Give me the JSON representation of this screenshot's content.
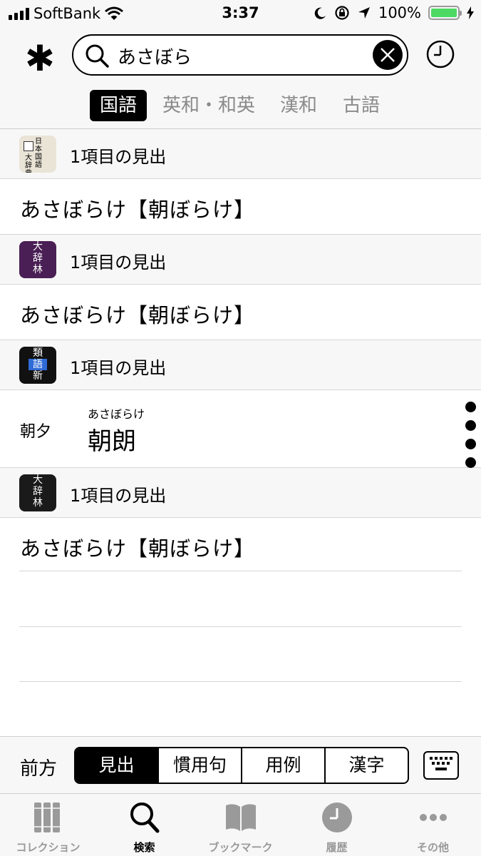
{
  "status_bar": {
    "carrier": "SoftBank",
    "time": "3:37",
    "battery": "100%",
    "battery_level": 1.0
  },
  "search": {
    "query": "あさぼら"
  },
  "header": {
    "asterisk": "✱"
  },
  "dict_tabs": [
    {
      "label": "国語",
      "active": true
    },
    {
      "label": "英和・和英",
      "active": false
    },
    {
      "label": "漢和",
      "active": false
    },
    {
      "label": "古語",
      "active": false
    }
  ],
  "sections": [
    {
      "title": "1項目の見出",
      "icon": "nihon-kokugo-daijiten-icon",
      "icon_text": [
        "日本国語",
        "大辞典"
      ],
      "entry": "あさぼらけ【朝ぼらけ】"
    },
    {
      "title": "1項目の見出",
      "icon": "daijirin-purple-icon",
      "icon_text": [
        "大",
        "辞",
        "林"
      ],
      "entry": "あさぼらけ【朝ぼらけ】"
    },
    {
      "title": "1項目の見出",
      "icon": "ruigo-shin-icon",
      "icon_text": [
        "類",
        "語",
        "新"
      ],
      "special": {
        "label": "朝夕",
        "ruby": "あさぼらけ",
        "word": "朝朗"
      }
    },
    {
      "title": "1項目の見出",
      "icon": "daijirin-black-icon",
      "icon_text": [
        "大",
        "辞",
        "林"
      ],
      "entry": "あさぼらけ【朝ぼらけ】"
    }
  ],
  "filter": {
    "label": "前方",
    "options": [
      {
        "label": "見出",
        "active": true
      },
      {
        "label": "慣用句",
        "active": false
      },
      {
        "label": "用例",
        "active": false
      },
      {
        "label": "漢字",
        "active": false
      }
    ]
  },
  "tab_bar": [
    {
      "label": "コレクション",
      "icon": "books-icon",
      "active": false
    },
    {
      "label": "検索",
      "icon": "search-icon",
      "active": true
    },
    {
      "label": "ブックマーク",
      "icon": "open-book-icon",
      "active": false
    },
    {
      "label": "履歴",
      "icon": "clock-icon",
      "active": false
    },
    {
      "label": "その他",
      "icon": "more-icon",
      "active": false
    }
  ]
}
